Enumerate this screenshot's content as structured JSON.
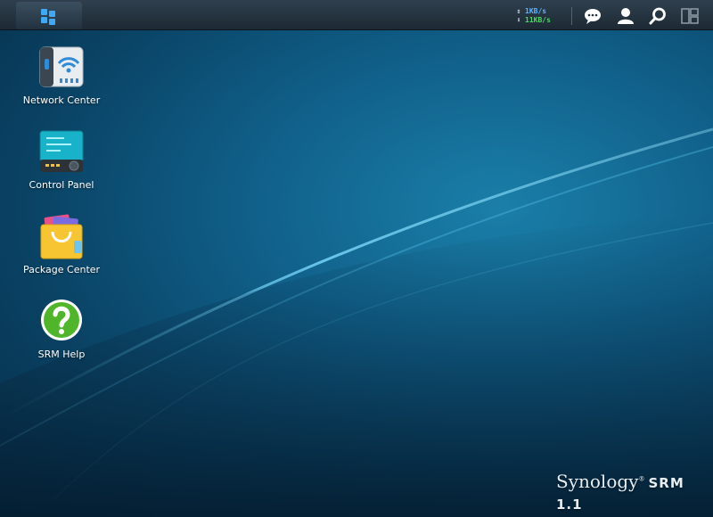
{
  "taskbar": {
    "main_menu_icon": "main-menu-grid-icon",
    "speed": {
      "upload": "1KB/s",
      "download": "11KB/s"
    },
    "icons": [
      "notifications-chat-icon",
      "user-icon",
      "search-icon",
      "widgets-icon"
    ]
  },
  "desktop": {
    "items": [
      {
        "label": "Network Center",
        "icon": "network-center-icon"
      },
      {
        "label": "Control Panel",
        "icon": "control-panel-icon"
      },
      {
        "label": "Package Center",
        "icon": "package-center-icon"
      },
      {
        "label": "SRM Help",
        "icon": "help-icon"
      }
    ]
  },
  "brand": {
    "name": "Synology",
    "product": "SRM 1.1"
  },
  "colors": {
    "upload": "#5fb3ff",
    "download": "#4cd964",
    "taskbar": "#26343f",
    "background": "#10608a"
  }
}
